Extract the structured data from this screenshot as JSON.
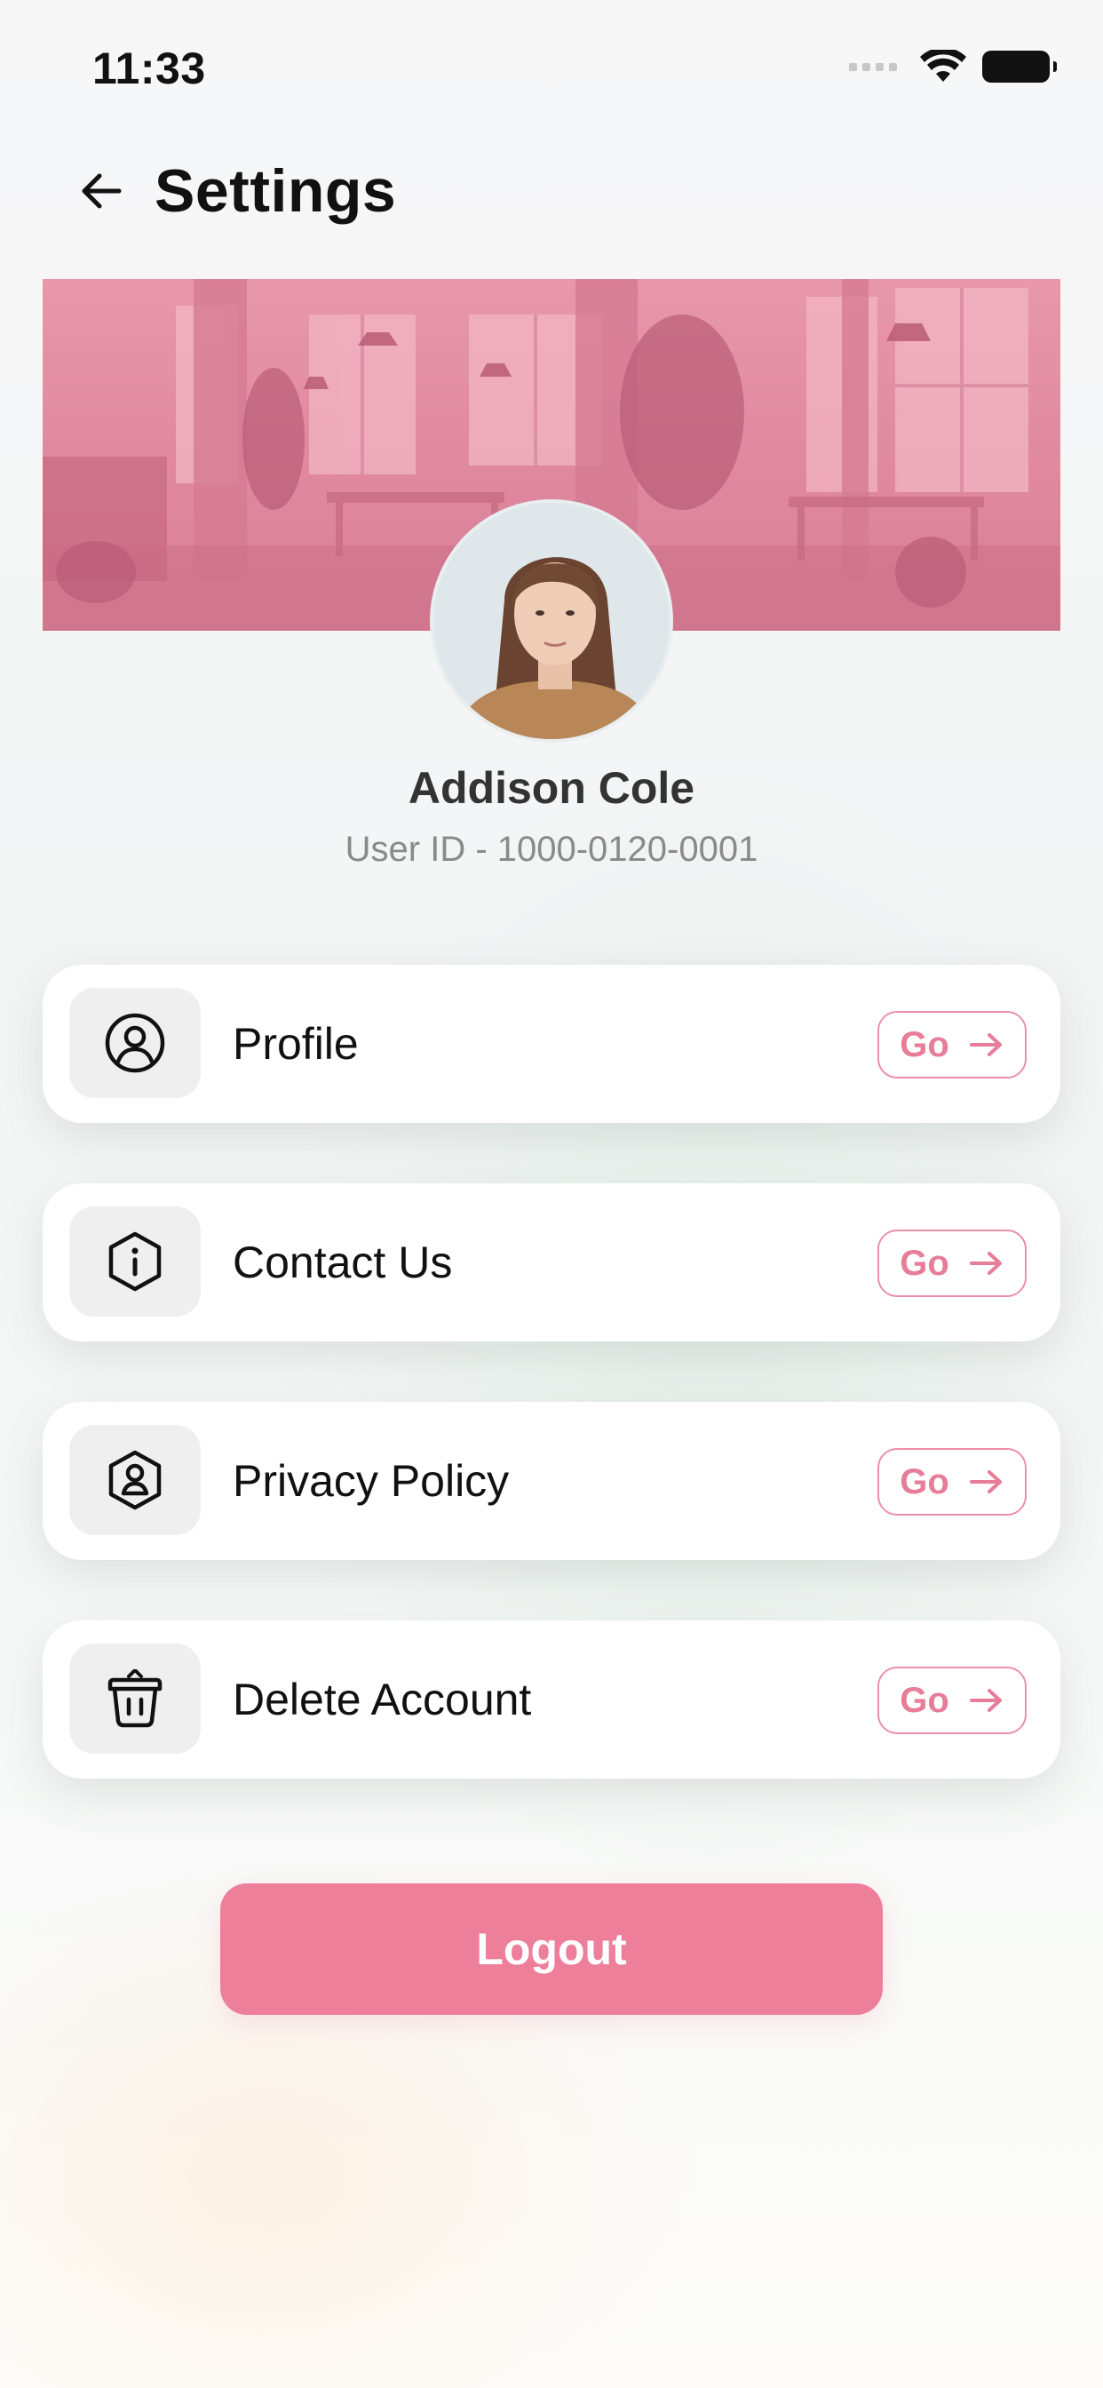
{
  "status_bar": {
    "time": "11:33"
  },
  "header": {
    "title": "Settings"
  },
  "user": {
    "name": "Addison Cole",
    "id_text": "User ID - 1000-0120-0001"
  },
  "menu": [
    {
      "label": "Profile",
      "icon": "user-circle-icon",
      "action": "Go"
    },
    {
      "label": "Contact Us",
      "icon": "info-icon",
      "action": "Go"
    },
    {
      "label": "Privacy Policy",
      "icon": "shield-user-icon",
      "action": "Go"
    },
    {
      "label": "Delete Account",
      "icon": "trash-icon",
      "action": "Go"
    }
  ],
  "logout_label": "Logout",
  "colors": {
    "accent": "#ed7f9b",
    "banner_tint": "#e48aa2",
    "card_bg": "#ffffff",
    "icon_tile_bg": "#efefef"
  }
}
